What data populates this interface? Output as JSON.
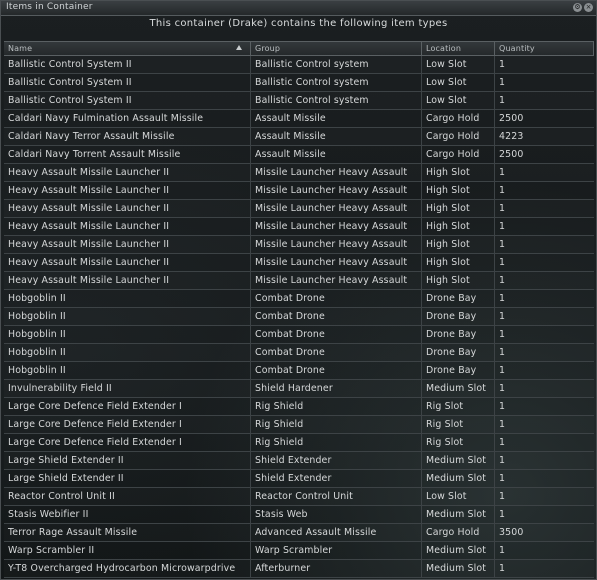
{
  "window": {
    "title": "Items in Container"
  },
  "subtitle": "This container (Drake) contains the following item types",
  "columns": {
    "name": "Name",
    "group": "Group",
    "location": "Location",
    "quantity": "Quantity"
  },
  "sort": {
    "column": "Name",
    "direction": "ascending"
  },
  "rows": [
    {
      "name": "Ballistic Control System II",
      "group": "Ballistic Control system",
      "location": "Low Slot",
      "quantity": "1"
    },
    {
      "name": "Ballistic Control System II",
      "group": "Ballistic Control system",
      "location": "Low Slot",
      "quantity": "1"
    },
    {
      "name": "Ballistic Control System II",
      "group": "Ballistic Control system",
      "location": "Low Slot",
      "quantity": "1"
    },
    {
      "name": "Caldari Navy Fulmination Assault Missile",
      "group": "Assault Missile",
      "location": "Cargo Hold",
      "quantity": "2500"
    },
    {
      "name": "Caldari Navy Terror Assault Missile",
      "group": "Assault Missile",
      "location": "Cargo Hold",
      "quantity": "4223"
    },
    {
      "name": "Caldari Navy Torrent Assault Missile",
      "group": "Assault Missile",
      "location": "Cargo Hold",
      "quantity": "2500"
    },
    {
      "name": "Heavy Assault Missile Launcher II",
      "group": "Missile Launcher Heavy Assault",
      "location": "High Slot",
      "quantity": "1"
    },
    {
      "name": "Heavy Assault Missile Launcher II",
      "group": "Missile Launcher Heavy Assault",
      "location": "High Slot",
      "quantity": "1"
    },
    {
      "name": "Heavy Assault Missile Launcher II",
      "group": "Missile Launcher Heavy Assault",
      "location": "High Slot",
      "quantity": "1"
    },
    {
      "name": "Heavy Assault Missile Launcher II",
      "group": "Missile Launcher Heavy Assault",
      "location": "High Slot",
      "quantity": "1"
    },
    {
      "name": "Heavy Assault Missile Launcher II",
      "group": "Missile Launcher Heavy Assault",
      "location": "High Slot",
      "quantity": "1"
    },
    {
      "name": "Heavy Assault Missile Launcher II",
      "group": "Missile Launcher Heavy Assault",
      "location": "High Slot",
      "quantity": "1"
    },
    {
      "name": "Heavy Assault Missile Launcher II",
      "group": "Missile Launcher Heavy Assault",
      "location": "High Slot",
      "quantity": "1"
    },
    {
      "name": "Hobgoblin II",
      "group": "Combat Drone",
      "location": "Drone Bay",
      "quantity": "1"
    },
    {
      "name": "Hobgoblin II",
      "group": "Combat Drone",
      "location": "Drone Bay",
      "quantity": "1"
    },
    {
      "name": "Hobgoblin II",
      "group": "Combat Drone",
      "location": "Drone Bay",
      "quantity": "1"
    },
    {
      "name": "Hobgoblin II",
      "group": "Combat Drone",
      "location": "Drone Bay",
      "quantity": "1"
    },
    {
      "name": "Hobgoblin II",
      "group": "Combat Drone",
      "location": "Drone Bay",
      "quantity": "1"
    },
    {
      "name": "Invulnerability Field II",
      "group": "Shield Hardener",
      "location": "Medium Slot",
      "quantity": "1"
    },
    {
      "name": "Large Core Defence Field Extender I",
      "group": "Rig Shield",
      "location": "Rig Slot",
      "quantity": "1"
    },
    {
      "name": "Large Core Defence Field Extender I",
      "group": "Rig Shield",
      "location": "Rig Slot",
      "quantity": "1"
    },
    {
      "name": "Large Core Defence Field Extender I",
      "group": "Rig Shield",
      "location": "Rig Slot",
      "quantity": "1"
    },
    {
      "name": "Large Shield Extender II",
      "group": "Shield Extender",
      "location": "Medium Slot",
      "quantity": "1"
    },
    {
      "name": "Large Shield Extender II",
      "group": "Shield Extender",
      "location": "Medium Slot",
      "quantity": "1"
    },
    {
      "name": "Reactor Control Unit II",
      "group": "Reactor Control Unit",
      "location": "Low Slot",
      "quantity": "1"
    },
    {
      "name": "Stasis Webifier II",
      "group": "Stasis Web",
      "location": "Medium Slot",
      "quantity": "1"
    },
    {
      "name": "Terror Rage Assault Missile",
      "group": "Advanced Assault Missile",
      "location": "Cargo Hold",
      "quantity": "3500"
    },
    {
      "name": "Warp Scrambler II",
      "group": "Warp Scrambler",
      "location": "Medium Slot",
      "quantity": "1"
    },
    {
      "name": "Y-T8 Overcharged Hydrocarbon Microwarpdrive",
      "group": "Afterburner",
      "location": "Medium Slot",
      "quantity": "1"
    }
  ]
}
